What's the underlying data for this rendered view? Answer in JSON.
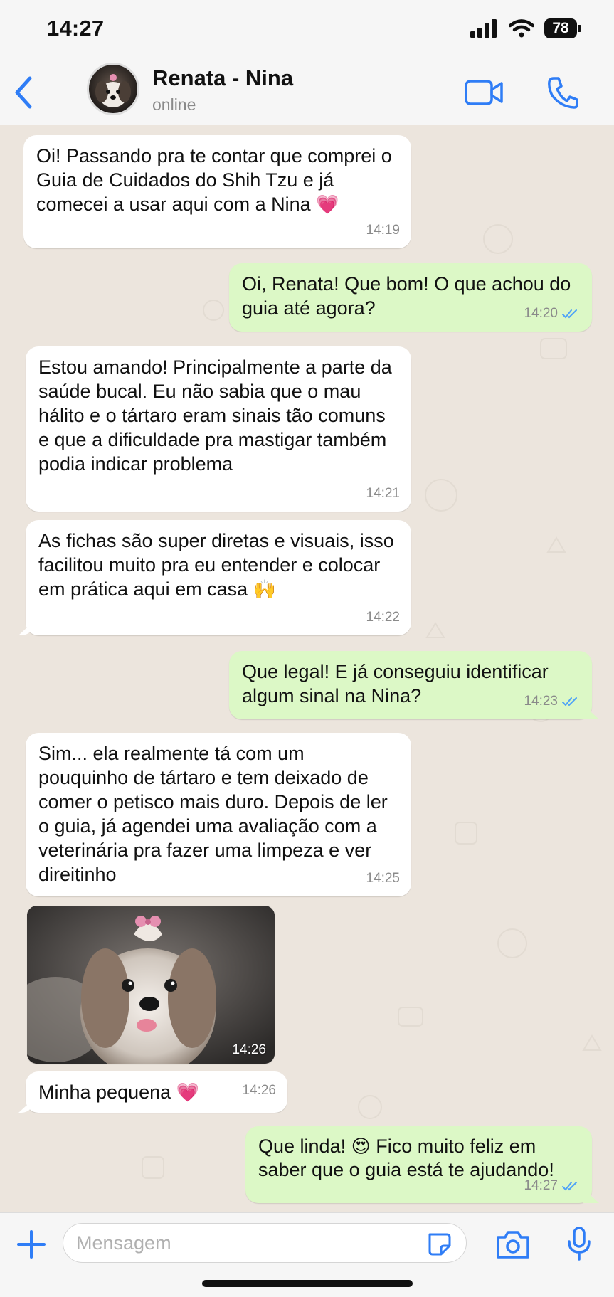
{
  "status_bar": {
    "time": "14:27",
    "battery": "78"
  },
  "header": {
    "contact_name": "Renata - Nina",
    "contact_status": "online"
  },
  "messages": [
    {
      "dir": "in",
      "text": "Oi! Passando pra te contar que comprei o Guia de Cuidados do Shih Tzu e já comecei a usar aqui com a Nina",
      "emoji": "💗",
      "time": "14:19"
    },
    {
      "dir": "out",
      "text": "Oi, Renata! Que bom! O que achou do guia até agora?",
      "time": "14:20"
    },
    {
      "dir": "in",
      "text": "Estou amando! Principalmente a parte da saúde bucal. Eu não sabia que o mau hálito e o tártaro eram sinais tão comuns e que a dificuldade pra mastigar também podia indicar problema",
      "time": "14:21"
    },
    {
      "dir": "in",
      "text": "As fichas são super diretas e visuais, isso facilitou muito pra eu entender e colocar em prática aqui em casa",
      "emoji": "🙌",
      "time": "14:22"
    },
    {
      "dir": "out",
      "text": "Que legal! E já conseguiu identificar algum sinal na Nina?",
      "time": "14:23"
    },
    {
      "dir": "in",
      "text": "Sim... ela realmente tá com um pouquinho de tártaro e tem deixado de comer o petisco mais duro. Depois de ler o guia, já agendei uma avaliação com a veterinária pra fazer uma limpeza e ver direitinho",
      "time": "14:25"
    },
    {
      "dir": "in",
      "type": "photo",
      "time": "14:26"
    },
    {
      "dir": "in",
      "text": "Minha pequena",
      "emoji": "💗",
      "time": "14:26"
    },
    {
      "dir": "out",
      "text_a": "Que linda!",
      "emoji": "😍",
      "text_b": "Fico muito feliz em saber que o guia está te ajudando!",
      "time": "14:27"
    }
  ],
  "compose": {
    "placeholder": "Mensagem"
  },
  "colors": {
    "accent": "#2f7df6",
    "incoming": "#ffffff",
    "outgoing": "#dcf8c6",
    "chat_bg": "#ece5dd"
  }
}
